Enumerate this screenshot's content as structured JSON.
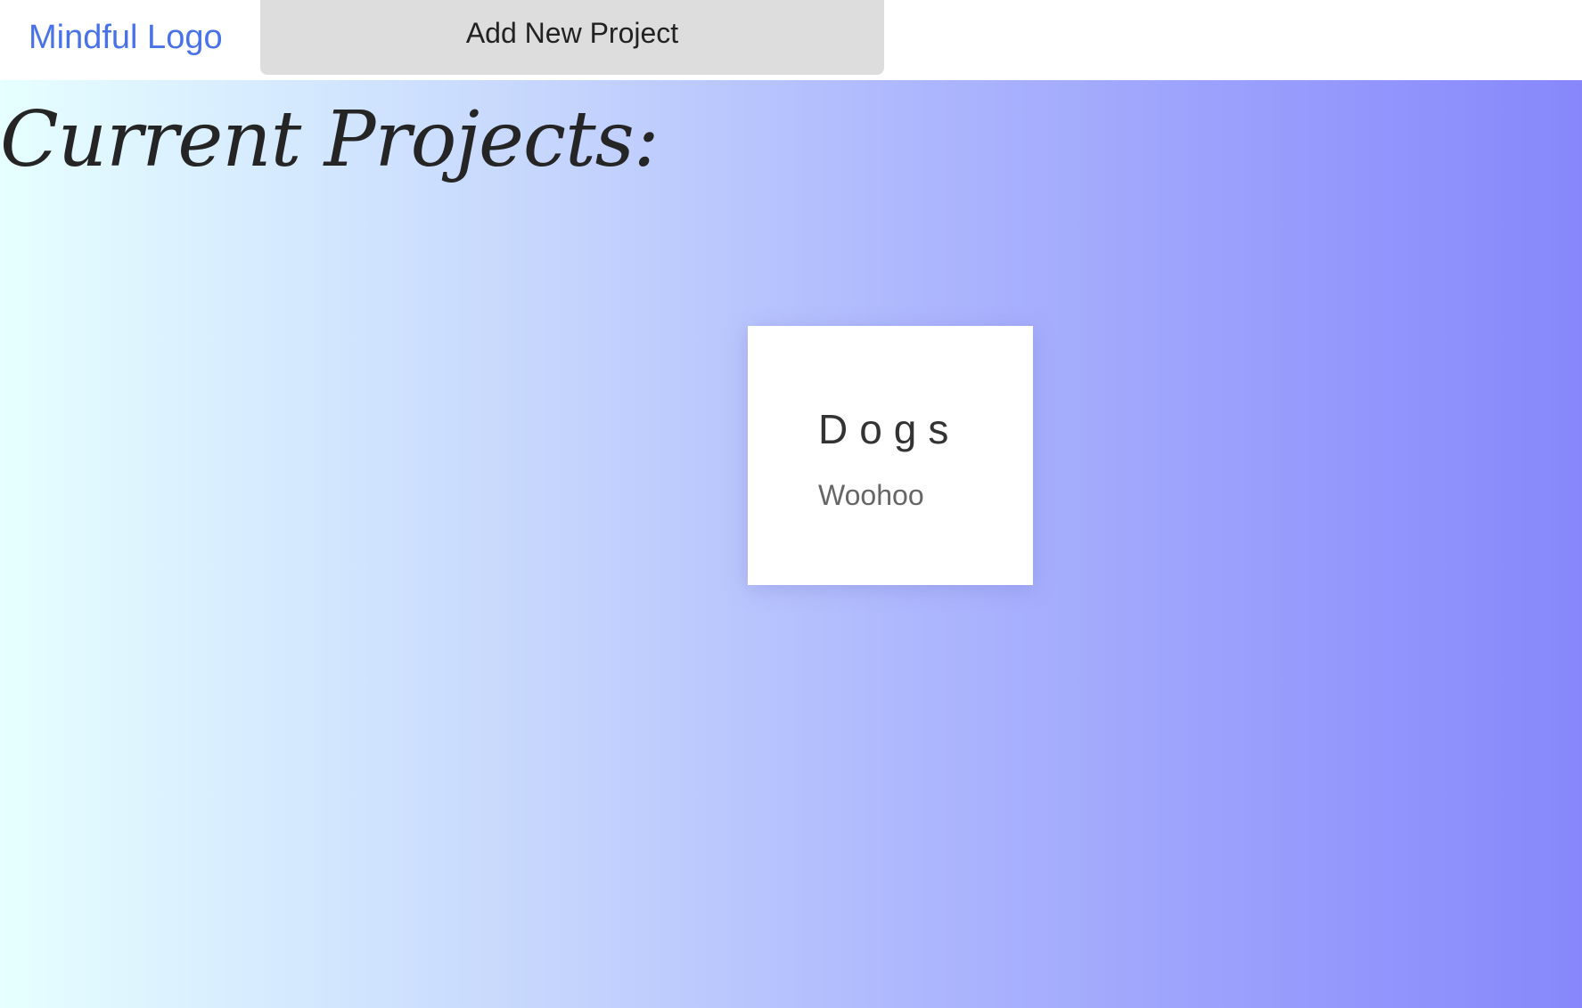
{
  "header": {
    "logo_text": "Mindful Logo",
    "add_project_label": "Add New Project"
  },
  "main": {
    "title": "Current Projects:",
    "projects": [
      {
        "name": "Dogs",
        "description": "Woohoo"
      }
    ]
  },
  "colors": {
    "logo_link": "#4a72e8",
    "button_background": "#dddddd",
    "gradient_start": "#e6ffff",
    "gradient_end": "#8787fb",
    "card_background": "#ffffff"
  }
}
